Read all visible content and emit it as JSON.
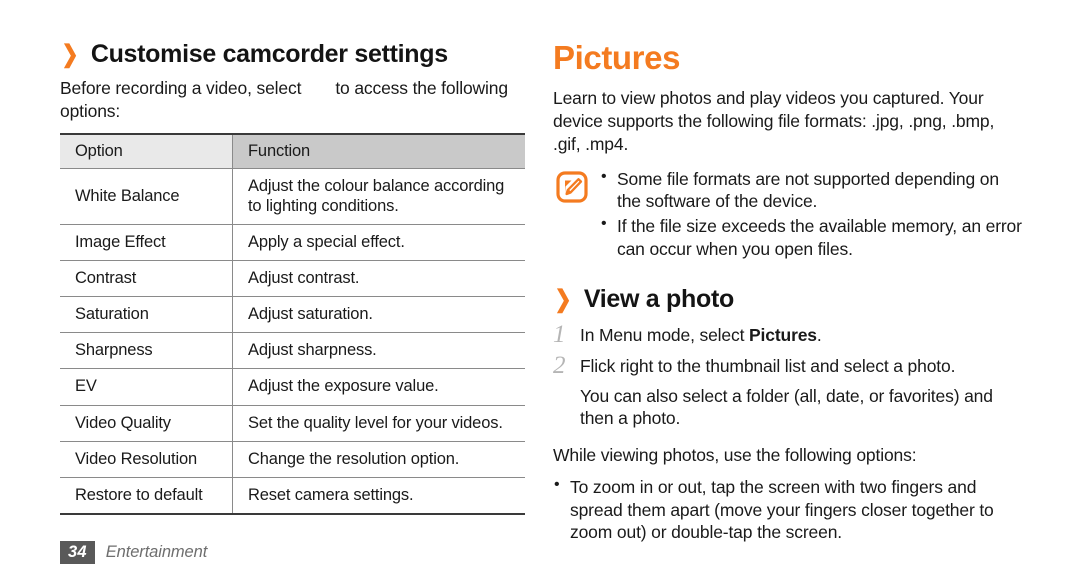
{
  "colors": {
    "accent_orange": "#F47B20",
    "header_option_bg": "#E9E9E9",
    "header_function_bg": "#C9C9C9",
    "rule": "#8A8A8A",
    "footer_box": "#595959",
    "step_number": "#B5B5B5"
  },
  "left": {
    "heading": "Customise camcorder settings",
    "chevron": "❯",
    "intro_before": "Before recording a video, select",
    "intro_after": "to access the following options:",
    "table": {
      "headers": [
        "Option",
        "Function"
      ],
      "rows": [
        [
          "White Balance",
          "Adjust the colour balance according to lighting conditions."
        ],
        [
          "Image Effect",
          "Apply a special effect."
        ],
        [
          "Contrast",
          "Adjust contrast."
        ],
        [
          "Saturation",
          "Adjust saturation."
        ],
        [
          "Sharpness",
          "Adjust sharpness."
        ],
        [
          "EV",
          "Adjust the exposure value."
        ],
        [
          "Video Quality",
          "Set the quality level for your videos."
        ],
        [
          "Video Resolution",
          "Change the resolution option."
        ],
        [
          "Restore to default",
          "Reset camera settings."
        ]
      ]
    }
  },
  "right": {
    "heading": "Pictures",
    "intro": "Learn to view photos and play videos you captured. Your device supports the following file formats: .jpg, .png, .bmp, .gif, .mp4.",
    "note": {
      "icon": "note-pen-icon",
      "bullets": [
        "Some file formats are not supported depending on the software of the device.",
        "If the file size exceeds the available memory, an error can occur when you open files."
      ]
    },
    "subheading": "View a photo",
    "chevron": "❯",
    "steps": [
      {
        "num": "1",
        "text_before": "In Menu mode, select ",
        "bold": "Pictures",
        "text_after": "."
      },
      {
        "num": "2",
        "text_before": "Flick right to the thumbnail list and select a photo.",
        "bold": "",
        "text_after": ""
      }
    ],
    "step2_sub": "You can also select a folder (all, date, or favorites) and then a photo.",
    "tail_intro": "While viewing photos, use the following options:",
    "tail_bullets": [
      "To zoom in or out, tap the screen with two fingers and spread them apart (move your fingers closer together to zoom out) or double-tap the screen."
    ]
  },
  "footer": {
    "page_number": "34",
    "section": "Entertainment"
  }
}
